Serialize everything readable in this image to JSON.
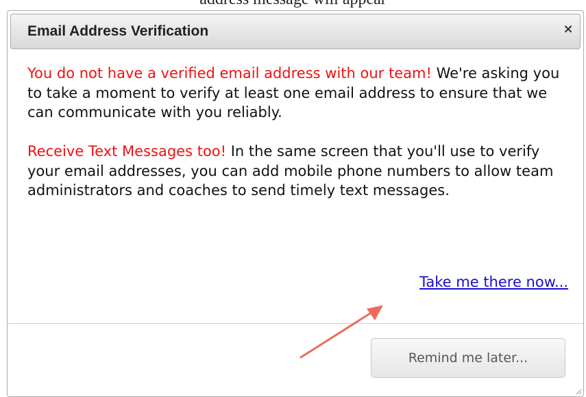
{
  "caption": {
    "text": "address message will appear"
  },
  "dialog": {
    "title": "Email Address Verification",
    "close_label": "×",
    "paragraph1": {
      "highlight": "You do not have a verified email address with our team!",
      "body": "We're asking you to take a moment to verify at least one email address to ensure that we can communicate with you reliably."
    },
    "paragraph2": {
      "highlight": "Receive Text Messages too!",
      "body": "In the same screen that you'll use to verify your email addresses, you can add mobile phone numbers to allow team administrators and coaches to send timely text messages."
    },
    "link_label": "Take me there now...",
    "remind_label": "Remind me later..."
  },
  "colors": {
    "highlight_text": "#ee1111",
    "link": "#1a0dcc",
    "annotation_arrow": "#ee6b5a"
  }
}
